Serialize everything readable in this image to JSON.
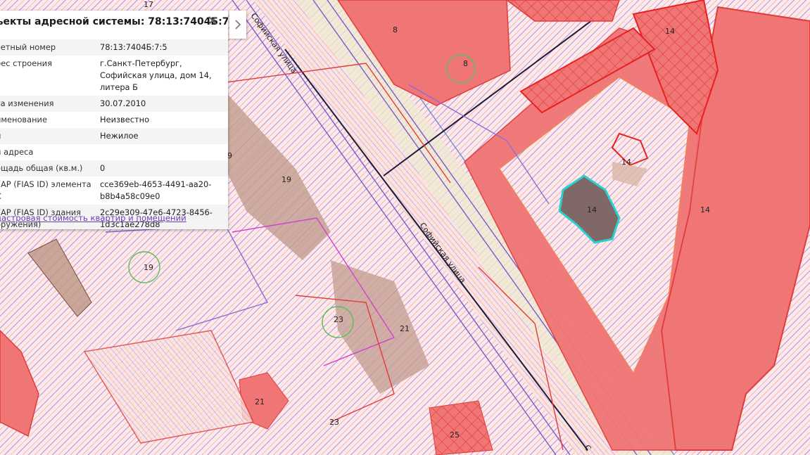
{
  "panel": {
    "title": "ъекты адресной системы: 78:13:7404Б:7:5",
    "rows": [
      {
        "key": "четный номер",
        "value": "78:13:7404Б:7:5"
      },
      {
        "key": "рес строения",
        "value": "г.Санкт-Петербург, Софийская улица, дом 14, литера Б"
      },
      {
        "key": "та изменения",
        "value": "30.07.2010"
      },
      {
        "key": "именование",
        "value": "Неизвестно"
      },
      {
        "key": "п",
        "value": "Нежилое"
      },
      {
        "key": "п адреса",
        "value": ""
      },
      {
        "key": "ощадь общая (кв.м.)",
        "value": "0"
      },
      {
        "key": "ГАР (FIAS ID) элемента \nС",
        "value": "cce369eb-4653-4491-aa20-b8b4a58c09e0"
      },
      {
        "key": "ГАР (FIAS ID) здания \nоружения)",
        "value": "2c29e309-47e6-4723-8456-1d3c1ae278d8"
      }
    ],
    "link": "дастровая стоимость квартир и помещений"
  },
  "map": {
    "labels": {
      "l17": "17",
      "l8a": "8",
      "l8b": "8",
      "l14a": "14",
      "l14b": "14",
      "l14c": "14",
      "l14d": "14",
      "l19a": "19",
      "l19b": "9",
      "l19c": "19",
      "l21a": "21",
      "l21b": "21",
      "l23a": "23",
      "l23b": "23",
      "l25": "25"
    },
    "streets": {
      "s1": "Софийская улица",
      "s2": "Софийская улица",
      "s3": "С"
    },
    "colors": {
      "parcel_fill": "#f07575",
      "parcel_edge": "#e23b3b",
      "hatch": "#8c6ad1",
      "building": "#c9a59a",
      "selected": "#2bd1d1"
    }
  }
}
